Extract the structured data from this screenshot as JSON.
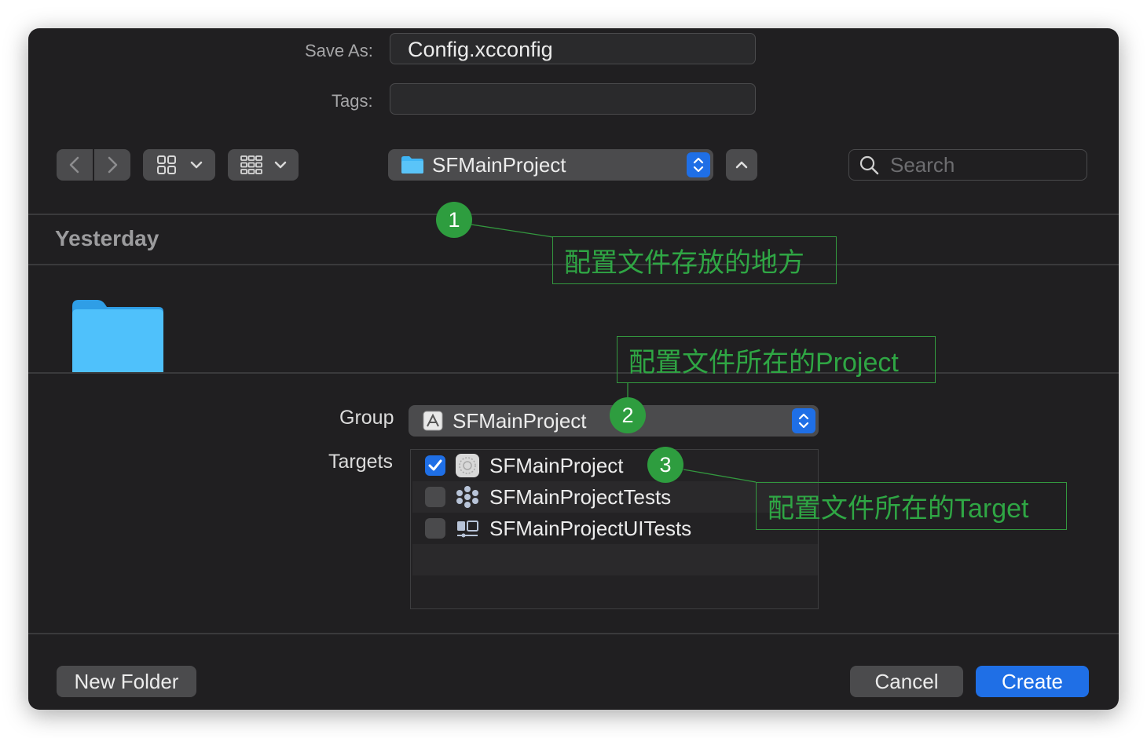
{
  "save_as": {
    "label": "Save As:",
    "value": "Config.xcconfig"
  },
  "tags": {
    "label": "Tags:",
    "value": ""
  },
  "toolbar": {
    "location": "SFMainProject",
    "search_placeholder": "Search"
  },
  "browser": {
    "section_header": "Yesterday"
  },
  "group": {
    "label": "Group",
    "value": "SFMainProject"
  },
  "targets": {
    "label": "Targets",
    "items": [
      {
        "name": "SFMainProject",
        "checked": true
      },
      {
        "name": "SFMainProjectTests",
        "checked": false
      },
      {
        "name": "SFMainProjectUITests",
        "checked": false
      }
    ]
  },
  "footer": {
    "new_folder": "New Folder",
    "cancel": "Cancel",
    "create": "Create"
  },
  "annotations": [
    {
      "number": "1",
      "text": "配置文件存放的地方"
    },
    {
      "number": "2",
      "text": "配置文件所在的Project"
    },
    {
      "number": "3",
      "text": "配置文件所在的Target"
    }
  ],
  "colors": {
    "dialog_bg": "#201f21",
    "accent_blue": "#1f6fe6",
    "annotation_green": "#2e9d3f",
    "folder_blue": "#3fb5f5"
  }
}
